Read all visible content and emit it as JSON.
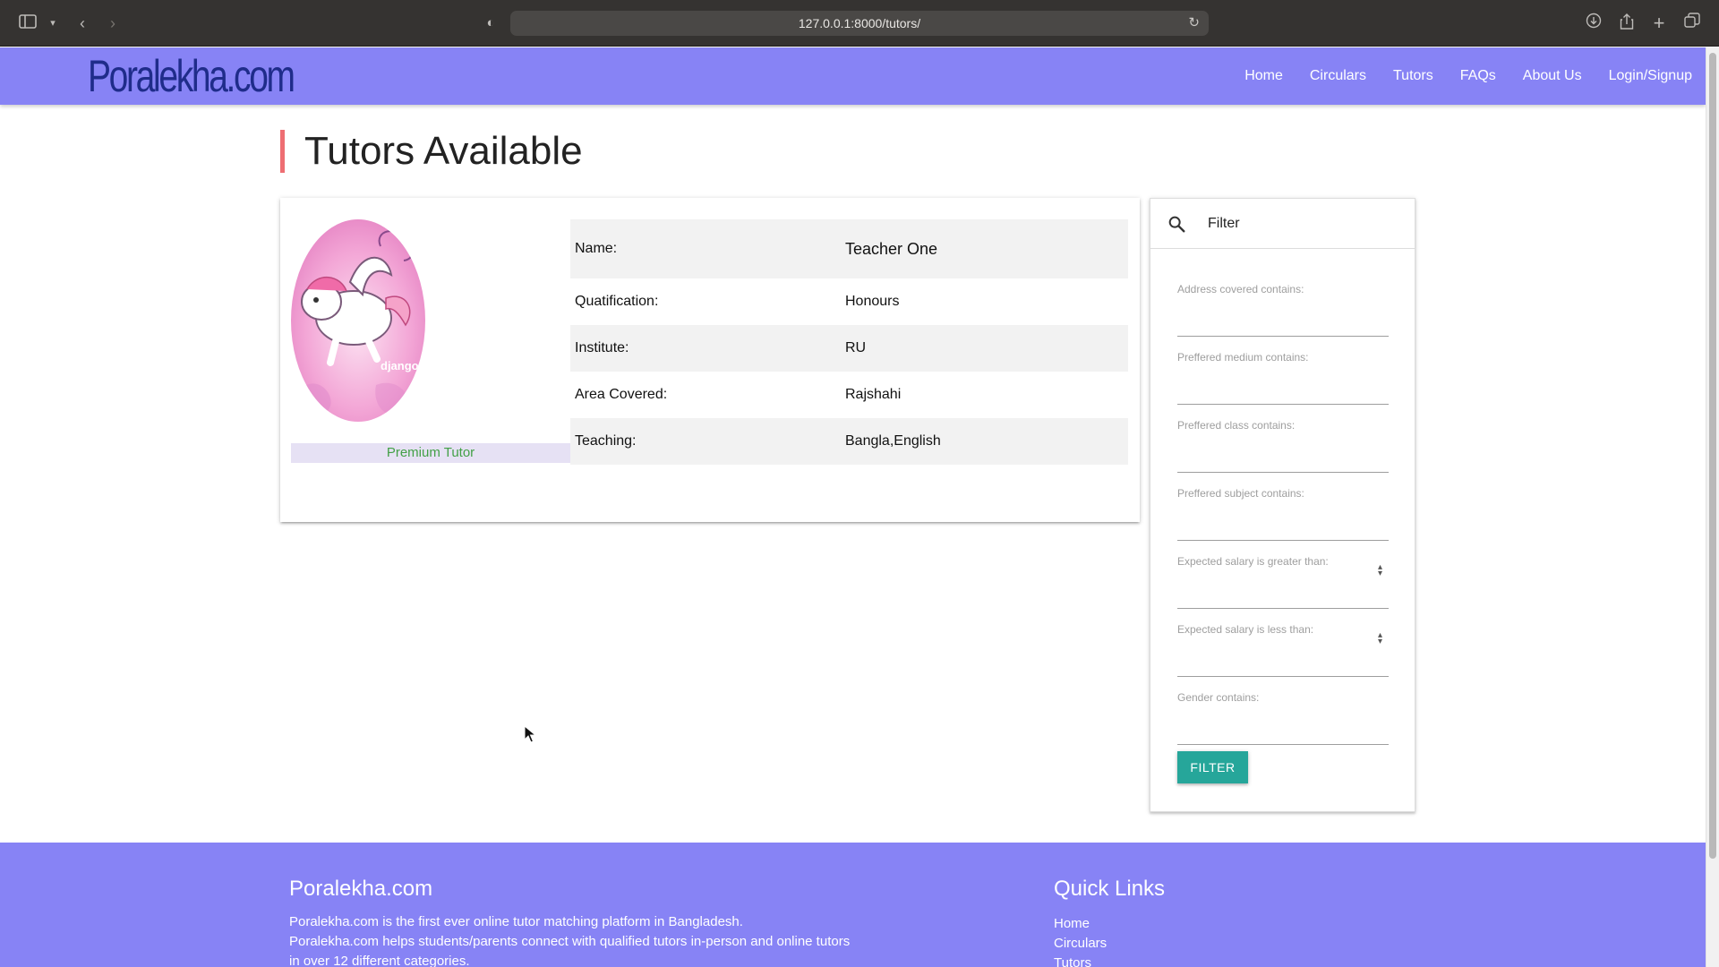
{
  "browser": {
    "url": "127.0.0.1:8000/tutors/"
  },
  "navbar": {
    "logo": "Poralekha.com",
    "links": [
      "Home",
      "Circulars",
      "Tutors",
      "FAQs",
      "About Us",
      "Login/Signup"
    ]
  },
  "page": {
    "title": "Tutors Available"
  },
  "tutor": {
    "badge": "Premium Tutor",
    "avatar_text": "django",
    "fields": [
      {
        "label": "Name:",
        "value": "Teacher One"
      },
      {
        "label": "Quatification:",
        "value": "Honours"
      },
      {
        "label": "Institute:",
        "value": "RU"
      },
      {
        "label": "Area Covered:",
        "value": "Rajshahi"
      },
      {
        "label": "Teaching:",
        "value": "Bangla,English"
      }
    ]
  },
  "filter": {
    "title": "Filter",
    "fields": [
      {
        "label": "Address covered contains:",
        "value": ""
      },
      {
        "label": "Preffered medium contains:",
        "value": ""
      },
      {
        "label": "Preffered class contains:",
        "value": ""
      },
      {
        "label": "Preffered subject contains:",
        "value": ""
      },
      {
        "label": "Expected salary is greater than:",
        "value": ""
      },
      {
        "label": "Expected salary is less than:",
        "value": ""
      },
      {
        "label": "Gender contains:",
        "value": ""
      }
    ],
    "button_label": "FILTER"
  },
  "footer": {
    "brand": "Poralekha.com",
    "description_1": "Poralekha.com is the first ever online tutor matching platform in Bangladesh.",
    "description_2": "Poralekha.com helps students/parents connect with qualified tutors in-person and online tutors in over 12 different categories.",
    "quick_links_title": "Quick Links",
    "quick_links": [
      "Home",
      "Circulars",
      "Tutors"
    ]
  },
  "colors": {
    "navbar_bg": "#8783f5",
    "title_accent": "#ee6e73",
    "filter_button": "#26a69a",
    "premium_text": "#43a047"
  }
}
